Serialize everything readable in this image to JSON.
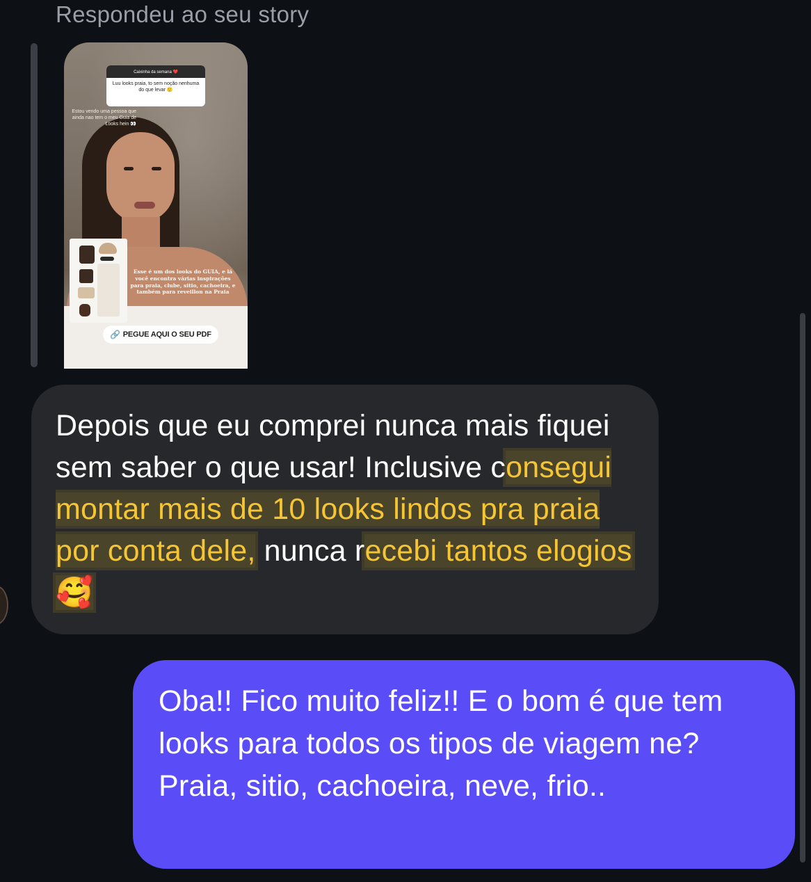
{
  "header": {
    "reply_label": "Respondeu ao seu story"
  },
  "story": {
    "question_title": "Caixinha da semana ❤️",
    "question_text": "Luu looks praia, to sem noção nenhuma do que levar 🙂",
    "note": "Estou vendo uma pessoa que ainda nao tem o meu Guia de Looks hein 👀",
    "caption": "Esse é um dos looks do GUIA, e lá você encontra várias inspirações para praia, clube, sitio, cachoeira, e também para reveillon na Praia",
    "link_label": "PEGUE AQUI O SEU PDF",
    "link_icon": "link-icon"
  },
  "messages": {
    "incoming": {
      "part1": "Depois que eu comprei nunca mais fiquei sem saber o que usar! Inclusive c",
      "highlight1": "onsegui montar mais de 10 looks lindos pra praia por conta dele,",
      "part2": " nunca r",
      "highlight2": "ecebi tantos elogios ",
      "emoji": "🥰"
    },
    "outgoing": {
      "text": "Oba!! Fico muito feliz!! E o bom é que tem looks para todos os tipos de viagem ne? Praia, sitio, cachoeira, neve, frio.."
    }
  },
  "colors": {
    "background": "#0d1014",
    "incoming_bubble": "#26282c",
    "outgoing_bubble": "#5a4df7",
    "highlight": "#f6c534",
    "label": "#9a9ea6"
  }
}
